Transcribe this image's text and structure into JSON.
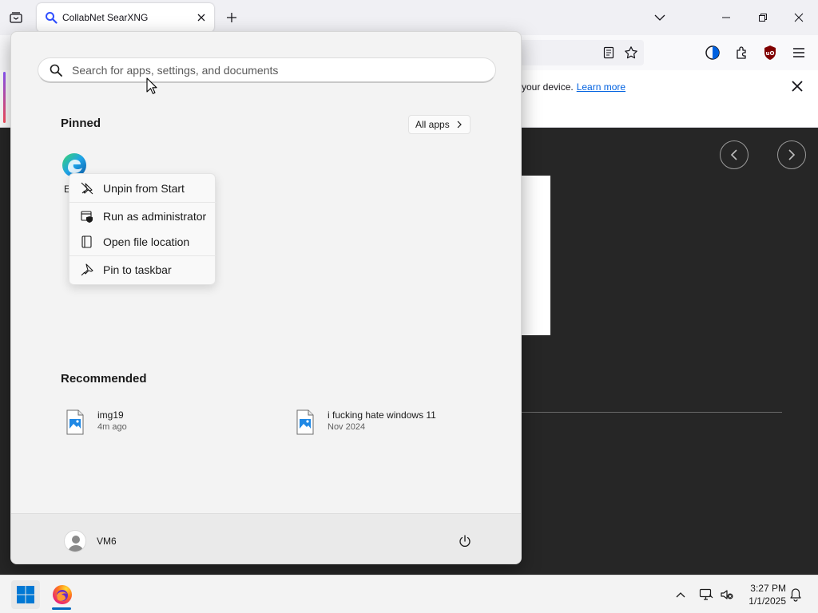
{
  "browser": {
    "tab_title": "CollabNet SearXNG",
    "notification": {
      "text": "your device.",
      "link": "Learn more"
    }
  },
  "start_menu": {
    "search_placeholder": "Search for apps, settings, and documents",
    "pinned_title": "Pinned",
    "all_apps_label": "All apps",
    "pinned_apps": [
      {
        "name": "E",
        "icon": "edge-icon"
      }
    ],
    "context_menu": [
      {
        "label": "Unpin from Start",
        "icon": "unpin-icon"
      },
      {
        "label": "Run as administrator",
        "icon": "admin-shield-icon"
      },
      {
        "label": "Open file location",
        "icon": "folder-icon"
      },
      {
        "label": "Pin to taskbar",
        "icon": "pin-icon"
      }
    ],
    "recommended_title": "Recommended",
    "recommended": [
      {
        "name": "img19",
        "time": "4m ago",
        "icon": "image-file-icon"
      },
      {
        "name": "i fucking hate windows 11",
        "time": "Nov 2024",
        "icon": "image-file-icon"
      }
    ],
    "user": {
      "name": "VM6"
    }
  },
  "taskbar": {
    "time": "3:27 PM",
    "date": "1/1/2025"
  },
  "colors": {
    "accent": "#0067c0",
    "link": "#0061e0",
    "start_bg": "#f3f3f3",
    "page_bg": "#262626"
  }
}
